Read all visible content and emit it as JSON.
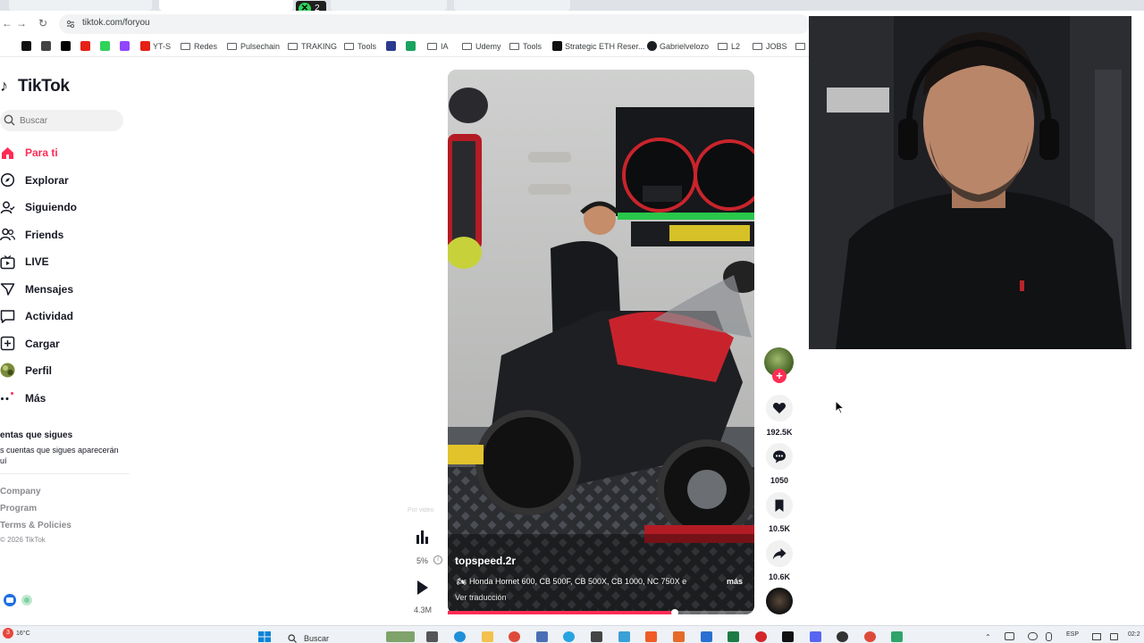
{
  "browser": {
    "url": "tiktok.com/foryou",
    "extension_badge_count": "2",
    "bookmarks": [
      {
        "label": "YT-S",
        "kind": "icon",
        "color": "#e62117"
      },
      {
        "label": "Redes",
        "kind": "folder"
      },
      {
        "label": "Pulsechain",
        "kind": "folder"
      },
      {
        "label": "TRAKING",
        "kind": "folder"
      },
      {
        "label": "Tools",
        "kind": "folder"
      },
      {
        "label": "IA",
        "kind": "folder"
      },
      {
        "label": "Udemy",
        "kind": "folder"
      },
      {
        "label": "Tools",
        "kind": "folder"
      },
      {
        "label": "Strategic ETH Reser...",
        "kind": "icon",
        "color": "#111111"
      },
      {
        "label": "Gabrielvelozо",
        "kind": "icon",
        "color": "#1b1f23"
      },
      {
        "label": "L2",
        "kind": "folder"
      },
      {
        "label": "JOBS",
        "kind": "folder"
      }
    ]
  },
  "tiktok": {
    "logo": "TikTok",
    "search_placeholder": "Buscar",
    "nav": [
      {
        "label": "Para ti",
        "icon": "home-icon",
        "active": true
      },
      {
        "label": "Explorar",
        "icon": "compass-icon",
        "active": false
      },
      {
        "label": "Siguiendo",
        "icon": "following-icon",
        "active": false
      },
      {
        "label": "Friends",
        "icon": "friends-icon",
        "active": false
      },
      {
        "label": "LIVE",
        "icon": "live-icon",
        "active": false
      },
      {
        "label": "Mensajes",
        "icon": "messages-icon",
        "active": false
      },
      {
        "label": "Actividad",
        "icon": "activity-icon",
        "active": false
      },
      {
        "label": "Cargar",
        "icon": "upload-icon",
        "active": false
      },
      {
        "label": "Perfil",
        "icon": "profile-icon",
        "active": false
      },
      {
        "label": "Más",
        "icon": "more-icon",
        "active": false
      }
    ],
    "following_title": "entas que sigues",
    "following_desc": "s cuentas que sigues aparecerán\nuí",
    "footer_links": [
      "Company",
      "Program",
      "Terms & Policies"
    ],
    "copyright": "© 2026 TikTok"
  },
  "video": {
    "author": "topspeed.2r",
    "caption": "Honda Hornet 600, CB 500F, CB 500X, CB 1000, NC 750X e",
    "more_label": "más",
    "translate_label": "Ver traducción",
    "progress": 0.74,
    "por_video_label": "Por video",
    "percent_label": "5%",
    "plays_label": "4.3M",
    "likes": "192.5K",
    "comments": "1050",
    "saves": "10.5K",
    "shares": "10.6K"
  },
  "taskbar": {
    "weather": "16°C",
    "notification_count": "3",
    "search_label": "Buscar",
    "language": "ESP",
    "time": "02:2"
  },
  "colors": {
    "accent": "#fe2c55",
    "text": "#161823",
    "muted": "#8a8b91"
  }
}
